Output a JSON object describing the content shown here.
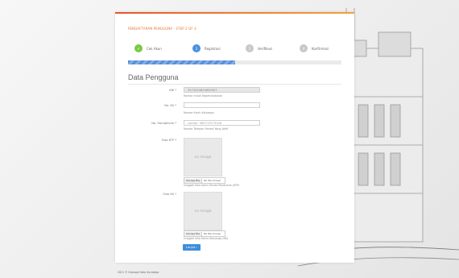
{
  "header": {
    "step_title": "PENDAFTARAN PENGGUNA - STEP 2 OF 4"
  },
  "steps": [
    {
      "label": "Cek Akun",
      "number": "✔",
      "status": "done",
      "color": "#7ac943"
    },
    {
      "label": "Registrasi",
      "number": "2",
      "status": "active",
      "color": "#4a90e2"
    },
    {
      "label": "Verifikasi",
      "number": "3",
      "status": "pending",
      "color": "#c8c8c8"
    },
    {
      "label": "Konfirmasi",
      "number": "4",
      "status": "pending",
      "color": "#c8c8c8"
    }
  ],
  "progress": {
    "fraction": 0.5
  },
  "section": {
    "title": "Data Pengguna"
  },
  "form": {
    "nik": {
      "label": "NIK *",
      "value": "3573054609890007",
      "help": "Nomor Induk Kependudukan"
    },
    "kk": {
      "label": "No. KK *",
      "value": "",
      "help": "Nomor Kartu Keluarga"
    },
    "hp": {
      "label": "No. Handphone *",
      "placeholder": "contoh: 085712573108",
      "help": "Nomor Telepon Ponsel Yang Aktif"
    },
    "ktp": {
      "label": "Foto KTP *",
      "image_text": "no image",
      "file_button": "Choose File",
      "file_name": "No file chosen",
      "help": "Unggah foto kartu Tanda Penduduk (KTP)"
    },
    "kkfoto": {
      "label": "Foto KK *",
      "image_text": "no image",
      "file_button": "Choose File",
      "file_name": "No file chosen",
      "help": "Unggah foto Kartu Keluarga (KK)"
    }
  },
  "submit": {
    "label": "Lanjut ›"
  },
  "footer": {
    "text": "2021 © Dukcapil Kota Surabaya"
  }
}
